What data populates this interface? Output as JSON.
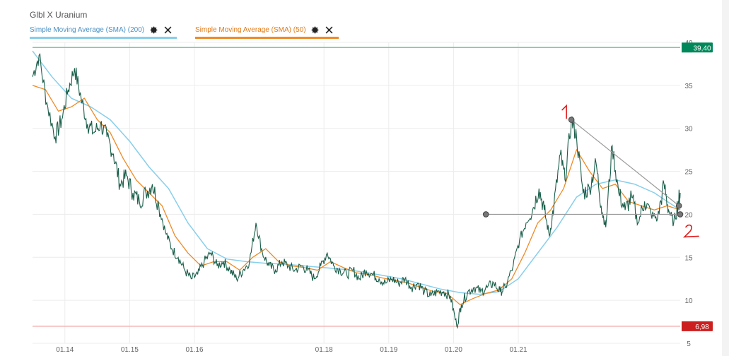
{
  "header": {
    "title": "Glbl X Uranium",
    "indicators": [
      {
        "label": "Simple Moving Average (SMA) (200)",
        "color": "#87CEEB",
        "gear_icon": "gear-icon",
        "close_icon": "close-icon"
      },
      {
        "label": "Simple Moving Average (SMA) (50)",
        "color": "#F08A24",
        "gear_icon": "gear-icon",
        "close_icon": "close-icon"
      }
    ]
  },
  "chart_data": {
    "type": "line",
    "title": "Glbl X Uranium",
    "xlabel": "",
    "ylabel": "",
    "x_ticks": [
      {
        "label": "01.14",
        "t": 0.5
      },
      {
        "label": "01.15",
        "t": 1.5
      },
      {
        "label": "01.16",
        "t": 2.5
      },
      {
        "label": "01.18",
        "t": 4.5
      },
      {
        "label": "01.19",
        "t": 5.5
      },
      {
        "label": "01.20",
        "t": 6.5
      },
      {
        "label": "01.21",
        "t": 7.5
      }
    ],
    "y_ticks": [
      5,
      10,
      15,
      20,
      25,
      30,
      35,
      40
    ],
    "ylim": [
      5,
      40
    ],
    "xlim": [
      0,
      10
    ],
    "grid": true,
    "price_series": {
      "name": "Glbl X Uranium",
      "color": "#1a5e4a",
      "points": [
        [
          0.0,
          36.0
        ],
        [
          0.1,
          38.5
        ],
        [
          0.22,
          33.0
        ],
        [
          0.35,
          29.0
        ],
        [
          0.45,
          31.0
        ],
        [
          0.55,
          34.5
        ],
        [
          0.65,
          37.0
        ],
        [
          0.75,
          33.5
        ],
        [
          0.85,
          30.5
        ],
        [
          0.95,
          29.5
        ],
        [
          1.05,
          30.5
        ],
        [
          1.15,
          29.0
        ],
        [
          1.25,
          27.0
        ],
        [
          1.35,
          23.5
        ],
        [
          1.45,
          24.5
        ],
        [
          1.55,
          22.5
        ],
        [
          1.65,
          21.5
        ],
        [
          1.75,
          22.5
        ],
        [
          1.85,
          23.5
        ],
        [
          1.95,
          21.0
        ],
        [
          2.05,
          18.0
        ],
        [
          2.15,
          16.0
        ],
        [
          2.25,
          15.0
        ],
        [
          2.35,
          13.5
        ],
        [
          2.45,
          12.5
        ],
        [
          2.55,
          13.0
        ],
        [
          2.65,
          14.5
        ],
        [
          2.75,
          15.5
        ],
        [
          2.85,
          14.0
        ],
        [
          2.95,
          14.5
        ],
        [
          3.05,
          13.5
        ],
        [
          3.15,
          12.5
        ],
        [
          3.25,
          13.5
        ],
        [
          3.35,
          14.5
        ],
        [
          3.45,
          19.0
        ],
        [
          3.55,
          15.5
        ],
        [
          3.65,
          14.0
        ],
        [
          3.75,
          13.5
        ],
        [
          3.85,
          14.5
        ],
        [
          3.95,
          14.0
        ],
        [
          4.05,
          13.5
        ],
        [
          4.15,
          14.0
        ],
        [
          4.25,
          13.5
        ],
        [
          4.35,
          12.5
        ],
        [
          4.45,
          14.0
        ],
        [
          4.55,
          15.5
        ],
        [
          4.65,
          14.0
        ],
        [
          4.75,
          13.5
        ],
        [
          4.85,
          13.0
        ],
        [
          4.95,
          13.5
        ],
        [
          5.05,
          12.5
        ],
        [
          5.15,
          13.5
        ],
        [
          5.25,
          13.0
        ],
        [
          5.35,
          12.5
        ],
        [
          5.45,
          12.0
        ],
        [
          5.55,
          12.5
        ],
        [
          5.65,
          12.0
        ],
        [
          5.75,
          12.5
        ],
        [
          5.85,
          11.5
        ],
        [
          5.95,
          12.0
        ],
        [
          6.05,
          11.0
        ],
        [
          6.15,
          10.5
        ],
        [
          6.25,
          11.0
        ],
        [
          6.35,
          11.0
        ],
        [
          6.45,
          10.5
        ],
        [
          6.55,
          7.0
        ],
        [
          6.62,
          9.5
        ],
        [
          6.72,
          11.0
        ],
        [
          6.82,
          11.5
        ],
        [
          6.92,
          11.0
        ],
        [
          7.02,
          11.5
        ],
        [
          7.12,
          12.0
        ],
        [
          7.22,
          11.0
        ],
        [
          7.3,
          11.5
        ],
        [
          7.42,
          14.0
        ],
        [
          7.52,
          17.0
        ],
        [
          7.62,
          19.0
        ],
        [
          7.72,
          20.5
        ],
        [
          7.82,
          23.0
        ],
        [
          7.9,
          20.5
        ],
        [
          7.98,
          17.5
        ],
        [
          8.05,
          21.0
        ],
        [
          8.15,
          27.0
        ],
        [
          8.22,
          24.0
        ],
        [
          8.32,
          31.0
        ],
        [
          8.4,
          29.0
        ],
        [
          8.5,
          22.5
        ],
        [
          8.6,
          23.0
        ],
        [
          8.7,
          26.0
        ],
        [
          8.78,
          21.0
        ],
        [
          8.85,
          18.5
        ],
        [
          8.95,
          28.0
        ],
        [
          9.05,
          22.5
        ],
        [
          9.15,
          20.5
        ],
        [
          9.25,
          22.0
        ],
        [
          9.35,
          19.0
        ],
        [
          9.45,
          21.5
        ],
        [
          9.55,
          20.0
        ],
        [
          9.65,
          19.5
        ],
        [
          9.75,
          23.5
        ],
        [
          9.82,
          20.5
        ],
        [
          9.9,
          19.0
        ],
        [
          9.97,
          21.5
        ],
        [
          10.0,
          22.5
        ]
      ]
    },
    "sma50": {
      "name": "Simple Moving Average (SMA) (50)",
      "color": "#F08A24",
      "points": [
        [
          0.0,
          35.0
        ],
        [
          0.2,
          34.5
        ],
        [
          0.4,
          32.0
        ],
        [
          0.6,
          32.5
        ],
        [
          0.8,
          33.5
        ],
        [
          1.0,
          31.0
        ],
        [
          1.2,
          29.5
        ],
        [
          1.4,
          26.5
        ],
        [
          1.6,
          24.0
        ],
        [
          1.8,
          22.5
        ],
        [
          2.0,
          21.0
        ],
        [
          2.2,
          17.5
        ],
        [
          2.4,
          15.5
        ],
        [
          2.6,
          14.0
        ],
        [
          2.8,
          14.5
        ],
        [
          3.0,
          14.5
        ],
        [
          3.2,
          13.5
        ],
        [
          3.4,
          15.0
        ],
        [
          3.6,
          16.0
        ],
        [
          3.8,
          14.5
        ],
        [
          4.0,
          14.0
        ],
        [
          4.2,
          13.8
        ],
        [
          4.4,
          13.5
        ],
        [
          4.6,
          14.5
        ],
        [
          4.8,
          13.8
        ],
        [
          5.0,
          13.2
        ],
        [
          5.2,
          13.0
        ],
        [
          5.4,
          12.6
        ],
        [
          5.6,
          12.3
        ],
        [
          5.8,
          12.0
        ],
        [
          6.0,
          11.5
        ],
        [
          6.2,
          11.0
        ],
        [
          6.4,
          10.8
        ],
        [
          6.6,
          9.5
        ],
        [
          6.8,
          10.2
        ],
        [
          7.0,
          10.8
        ],
        [
          7.2,
          11.2
        ],
        [
          7.4,
          12.5
        ],
        [
          7.6,
          15.5
        ],
        [
          7.8,
          19.0
        ],
        [
          8.0,
          20.5
        ],
        [
          8.2,
          23.0
        ],
        [
          8.4,
          27.5
        ],
        [
          8.6,
          25.0
        ],
        [
          8.8,
          23.0
        ],
        [
          9.0,
          23.5
        ],
        [
          9.2,
          21.5
        ],
        [
          9.4,
          21.0
        ],
        [
          9.6,
          20.5
        ],
        [
          9.8,
          21.0
        ],
        [
          10.0,
          20.5
        ]
      ]
    },
    "sma200": {
      "name": "Simple Moving Average (SMA) (200)",
      "color": "#87CEEB",
      "points": [
        [
          0.0,
          39.0
        ],
        [
          0.3,
          36.0
        ],
        [
          0.6,
          33.5
        ],
        [
          0.9,
          32.5
        ],
        [
          1.2,
          31.0
        ],
        [
          1.5,
          28.5
        ],
        [
          1.8,
          25.5
        ],
        [
          2.1,
          23.0
        ],
        [
          2.4,
          19.0
        ],
        [
          2.7,
          16.0
        ],
        [
          3.0,
          14.8
        ],
        [
          3.3,
          14.5
        ],
        [
          3.6,
          14.3
        ],
        [
          3.9,
          14.2
        ],
        [
          4.2,
          14.0
        ],
        [
          4.5,
          13.8
        ],
        [
          4.8,
          13.6
        ],
        [
          5.1,
          13.3
        ],
        [
          5.4,
          12.9
        ],
        [
          5.7,
          12.5
        ],
        [
          6.0,
          11.9
        ],
        [
          6.3,
          11.3
        ],
        [
          6.6,
          10.9
        ],
        [
          6.9,
          10.7
        ],
        [
          7.2,
          11.0
        ],
        [
          7.5,
          12.5
        ],
        [
          7.8,
          15.5
        ],
        [
          8.1,
          18.5
        ],
        [
          8.4,
          22.0
        ],
        [
          8.7,
          23.5
        ],
        [
          9.0,
          24.0
        ],
        [
          9.3,
          23.5
        ],
        [
          9.6,
          22.5
        ],
        [
          9.8,
          21.5
        ],
        [
          10.0,
          20.5
        ]
      ]
    },
    "levels": [
      {
        "name": "high-level",
        "value": 39.4,
        "label": "39,40",
        "color": "#00885a",
        "line_color": "#7cc8a2"
      },
      {
        "name": "low-level",
        "value": 6.98,
        "label": "6,98",
        "color": "#cc1f1f",
        "line_color": "#f4b3b3"
      }
    ],
    "trendlines": [
      {
        "name": "descending-trendline",
        "from": [
          8.32,
          31.0
        ],
        "to": [
          9.98,
          21.0
        ],
        "color": "#999999"
      },
      {
        "name": "horizontal-support-line",
        "from": [
          7.0,
          20.0
        ],
        "to": [
          10.0,
          20.0
        ],
        "color": "#999999"
      }
    ],
    "annotations": [
      {
        "name": "annotation-1",
        "text": "1",
        "color": "#e01b1b"
      },
      {
        "name": "annotation-2",
        "text": "2",
        "color": "#e01b1b"
      }
    ]
  }
}
